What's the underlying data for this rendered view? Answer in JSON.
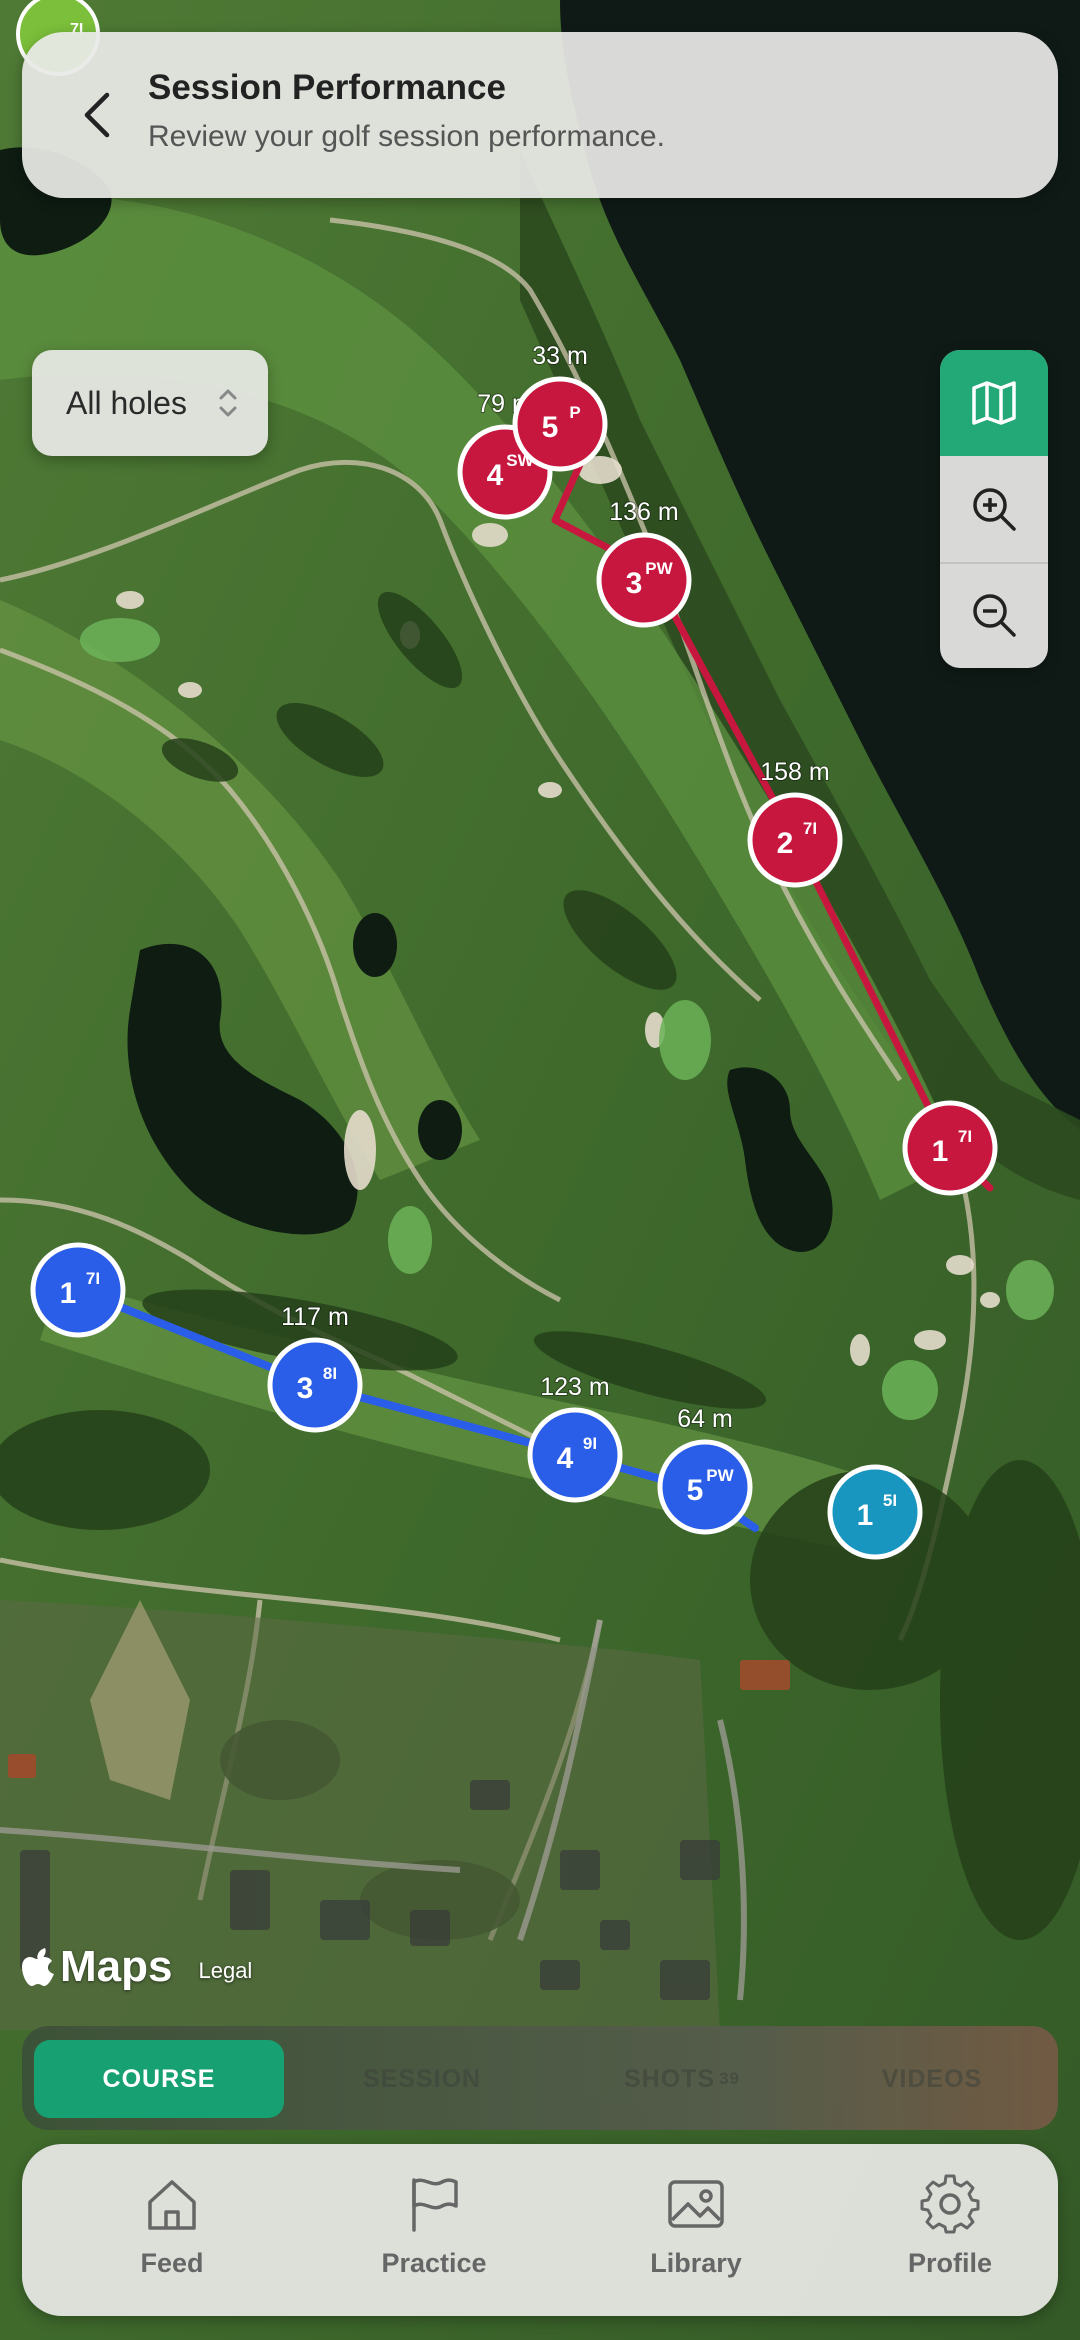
{
  "header": {
    "title": "Session Performance",
    "subtitle": "Review your golf session performance."
  },
  "hole_selector": {
    "label": "All holes"
  },
  "map": {
    "attribution": "Maps",
    "legal": "Legal",
    "red_shots": [
      {
        "num": "1",
        "club": "7I",
        "distance": ""
      },
      {
        "num": "2",
        "club": "7I",
        "distance": "158 m"
      },
      {
        "num": "3",
        "club": "PW",
        "distance": "136 m"
      },
      {
        "num": "4",
        "club": "SW",
        "distance": "79 m"
      },
      {
        "num": "5",
        "club": "P",
        "distance": "33 m"
      }
    ],
    "blue_shots": [
      {
        "num": "1",
        "club": "7I",
        "distance": ""
      },
      {
        "num": "3",
        "club": "8I",
        "distance": "117 m"
      },
      {
        "num": "4",
        "club": "9I",
        "distance": "123 m"
      },
      {
        "num": "5",
        "club": "PW",
        "distance": "64 m"
      }
    ],
    "teal_shot": {
      "num": "1",
      "club": "5I"
    },
    "corner_marker": {
      "club": "7I"
    },
    "colors": {
      "red": "#c8173e",
      "blue": "#2a5ee8",
      "teal": "#1996c0"
    }
  },
  "tabs": {
    "course": "COURSE",
    "session": "SESSION",
    "shots": "SHOTS",
    "shots_count": "39",
    "videos": "VIDEOS"
  },
  "nav": {
    "feed": "Feed",
    "practice": "Practice",
    "library": "Library",
    "profile": "Profile"
  },
  "icons": {
    "back": "chevron-left-icon",
    "map_type": "map-icon",
    "zoom_in": "zoom-in-icon",
    "zoom_out": "zoom-out-icon",
    "feed": "home-icon",
    "practice": "flag-icon",
    "library": "image-icon",
    "profile": "gear-icon"
  }
}
